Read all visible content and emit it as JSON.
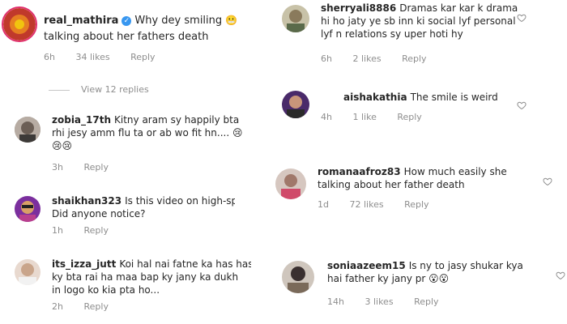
{
  "comments": [
    {
      "id": "c1",
      "username": "real_mathira",
      "verified": true,
      "text": "Why dey smiling",
      "text2": "talking about her fathers death",
      "emoji": [
        "😬"
      ],
      "time": "6h",
      "likes": "34 likes",
      "reply": "Reply",
      "view_replies": "View 12 replies"
    },
    {
      "id": "c2",
      "username": "zobia_17th",
      "text": "Kitny aram sy happily bta",
      "text2": "rhi jesy amm flu ta or ab wo fit hn....",
      "emoji": [
        "😢",
        "😢",
        "😢"
      ],
      "time": "3h",
      "reply": "Reply"
    },
    {
      "id": "c3",
      "username": "shaikhan323",
      "text": "Is this video on high-spee",
      "text2": "Did anyone notice?",
      "time": "1h",
      "reply": "Reply"
    },
    {
      "id": "c4",
      "username": "its_izza_jutt",
      "text": "Koi hal nai fatne ka has has",
      "text2": "ky bta rai ha maa bap ky jany ka dukh",
      "text3": "in logo ko kia pta ho...",
      "time": "2h",
      "reply": "Reply"
    },
    {
      "id": "c5",
      "username": "sherryali8886",
      "text": "Dramas kar kar k drama",
      "text2": "hi ho jaty ye sb inn ki social lyf personal",
      "text3": "lyf n relations sy uper hoti hy",
      "time": "6h",
      "likes": "2 likes",
      "reply": "Reply"
    },
    {
      "id": "c6",
      "username": "aishakathia",
      "text": "The smile is weird",
      "time": "4h",
      "likes": "1 like",
      "reply": "Reply"
    },
    {
      "id": "c7",
      "username": "romanaafroz83",
      "text": "How much easily she",
      "text2": "talking about her father death",
      "time": "1d",
      "likes": "72 likes",
      "reply": "Reply"
    },
    {
      "id": "c8",
      "username": "soniaazeem15",
      "text": "Is ny to jasy shukar kya",
      "text2": "hai father ky jany pr",
      "emoji": [
        "😮",
        "😮"
      ],
      "time": "14h",
      "likes": "3 likes",
      "reply": "Reply"
    }
  ],
  "colors": {
    "text": "#262626",
    "meta": "#8e8e8e",
    "verified": "#3897f0"
  }
}
